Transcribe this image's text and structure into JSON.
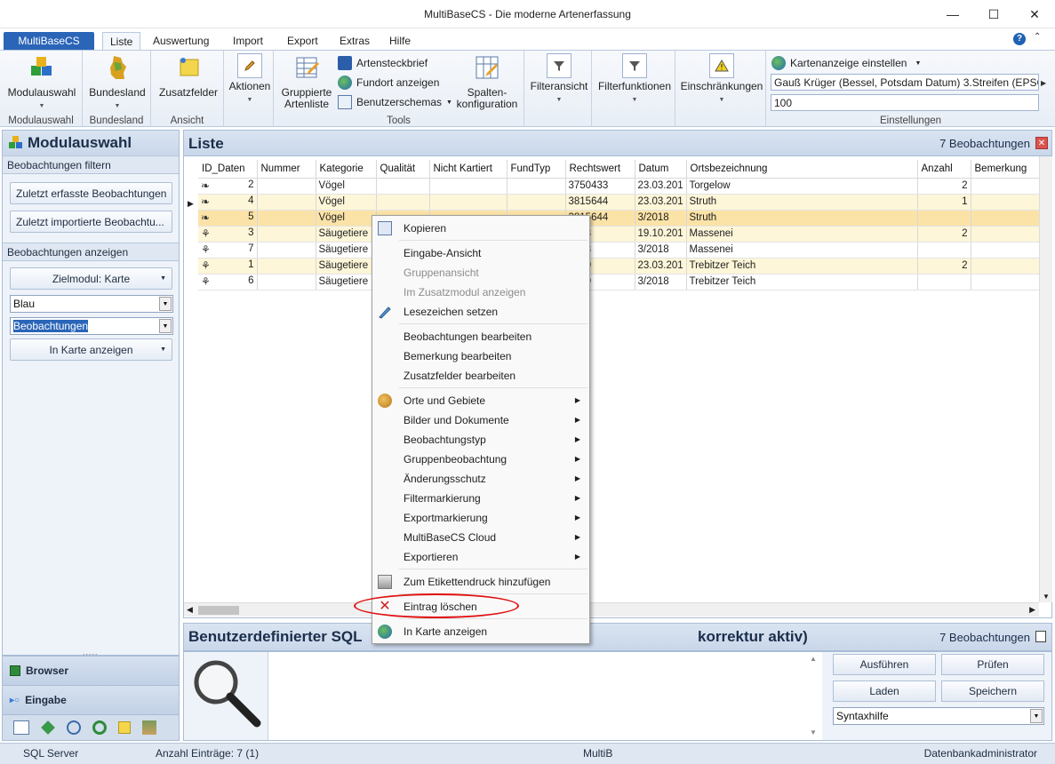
{
  "window": {
    "title": "MultiBaseCS - Die moderne Artenerfassung"
  },
  "ribbon_tabs": {
    "app": "MultiBaseCS",
    "liste": "Liste",
    "auswertung": "Auswertung",
    "import": "Import",
    "export": "Export",
    "extras": "Extras",
    "hilfe": "Hilfe"
  },
  "ribbon": {
    "modulauswahl": "Modulauswahl",
    "bundesland": "Bundesland",
    "zusatzfelder": "Zusatzfelder",
    "aktionen": "Aktionen",
    "gruppierte_line1": "Gruppierte",
    "gruppierte_line2": "Artenliste",
    "artensteckbrief": "Artensteckbrief",
    "fundort": "Fundort anzeigen",
    "benutzerschemas": "Benutzerschemas",
    "spalten_line1": "Spalten-",
    "spalten_line2": "konfiguration",
    "filteransicht": "Filteransicht",
    "filterfunktionen": "Filterfunktionen",
    "einschraenkungen": "Einschränkungen",
    "kartenanzeige": "Kartenanzeige einstellen",
    "projection_value": "Gauß Krüger (Bessel, Potsdam Datum) 3.Streifen (EPSG: 3",
    "zoom_value": "100",
    "group_labels": {
      "modulauswahl": "Modulauswahl",
      "bundesland": "Bundesland",
      "ansicht": "Ansicht",
      "tools": "Tools",
      "einstellungen": "Einstellungen"
    }
  },
  "left_panel": {
    "title": "Modulauswahl",
    "section_filter": "Beobachtungen filtern",
    "btn_zuletzt_erfasst": "Zuletzt erfasste Beobachtungen",
    "btn_zuletzt_importiert": "Zuletzt  importierte Beobachtu...",
    "section_anzeigen": "Beobachtungen anzeigen",
    "btn_zielmodul": "Zielmodul: Karte",
    "combo_farbe": "Blau",
    "combo_beobachtungen": "Beobachtungen",
    "btn_in_karte": "In Karte anzeigen",
    "nav_browser": "Browser",
    "nav_eingabe": "Eingabe"
  },
  "list": {
    "title": "Liste",
    "count": "7 Beobachtungen",
    "columns": [
      "ID_Daten",
      "Nummer",
      "Kategorie",
      "Qualität",
      "Nicht Kartiert",
      "FundTyp",
      "Rechtswert",
      "Datum",
      "Ortsbezeichnung",
      "Anzahl",
      "Bemerkung"
    ],
    "rows": [
      {
        "id": "2",
        "kategorie": "Vögel",
        "rechtswert": "3750433",
        "datum": "23.03.201",
        "ort": "Torgelow",
        "anzahl": "2"
      },
      {
        "id": "4",
        "kategorie": "Vögel",
        "rechtswert": "3815644",
        "datum": "23.03.201",
        "ort": "Struth",
        "anzahl": "1"
      },
      {
        "id": "5",
        "kategorie": "Vögel",
        "rechtswert": "3815644",
        "datum": "3/2018",
        "ort": "Struth",
        "anzahl": ""
      },
      {
        "id": "3",
        "kategorie": "Säugetiere",
        "rechtswert": "4248",
        "datum": "19.10.201",
        "ort": "Massenei",
        "anzahl": "2"
      },
      {
        "id": "7",
        "kategorie": "Säugetiere",
        "rechtswert": "4248",
        "datum": "3/2018",
        "ort": "Massenei",
        "anzahl": ""
      },
      {
        "id": "1",
        "kategorie": "Säugetiere",
        "rechtswert": "5170",
        "datum": "23.03.201",
        "ort": "Trebitzer Teich",
        "anzahl": "2"
      },
      {
        "id": "6",
        "kategorie": "Säugetiere",
        "rechtswert": "5170",
        "datum": "3/2018",
        "ort": "Trebitzer Teich",
        "anzahl": ""
      }
    ]
  },
  "sql_panel": {
    "title_visible": "Benutzerdefinierter SQL",
    "title_tail": "korrektur aktiv)",
    "count": "7 Beobachtungen",
    "btn_ausfuehren": "Ausführen",
    "btn_pruefen": "Prüfen",
    "btn_laden": "Laden",
    "btn_speichern": "Speichern",
    "syntaxhilfe": "Syntaxhilfe"
  },
  "context_menu": {
    "kopieren": "Kopieren",
    "eingabe_ansicht": "Eingabe-Ansicht",
    "gruppenansicht": "Gruppenansicht",
    "zusatzmodul": "Im Zusatzmodul anzeigen",
    "lesezeichen": "Lesezeichen setzen",
    "beob_bearbeiten": "Beobachtungen bearbeiten",
    "bemerkung_bearbeiten": "Bemerkung bearbeiten",
    "zusatzfelder_bearbeiten": "Zusatzfelder bearbeiten",
    "orte": "Orte und Gebiete",
    "bilder": "Bilder und Dokumente",
    "beobachtungstyp": "Beobachtungstyp",
    "gruppenbeobachtung": "Gruppenbeobachtung",
    "aenderungsschutz": "Änderungsschutz",
    "filtermarkierung": "Filtermarkierung",
    "exportmarkierung": "Exportmarkierung",
    "cloud": "MultiBaseCS Cloud",
    "exportieren": "Exportieren",
    "etikettendruck": "Zum Etikettendruck hinzufügen",
    "eintrag_loeschen": "Eintrag löschen",
    "in_karte": "In Karte anzeigen"
  },
  "status": {
    "server": "SQL Server",
    "eintraege": "Anzahl Einträge: 7 (1)",
    "db": "MultiB",
    "user": "Datenbankadministrator"
  }
}
